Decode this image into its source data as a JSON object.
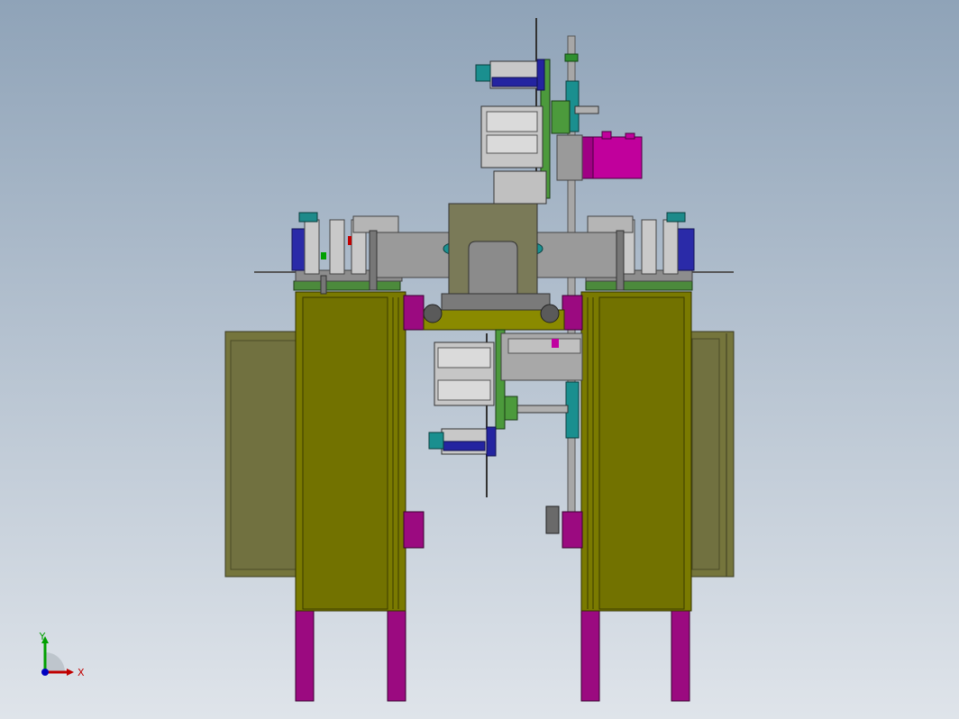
{
  "viewport": {
    "background_top": "#8fa3b8",
    "background_bottom": "#dfe4ea"
  },
  "colors": {
    "olive_body": "#787800",
    "olive_panel": "#6e6e3a",
    "magenta": "#99007a",
    "gray_part": "#9a9a9a",
    "dark_gray": "#6f6f6f",
    "green": "#3f8f3f",
    "teal": "#1a8f8f",
    "blue": "#2020a0",
    "pink_motor": "#c000a0",
    "block_olive": "#7b7b55"
  },
  "triad": {
    "x_label": "X",
    "y_label": "Y",
    "x_color": "#c00000",
    "y_color": "#00a000",
    "z_color": "#0000c0"
  }
}
